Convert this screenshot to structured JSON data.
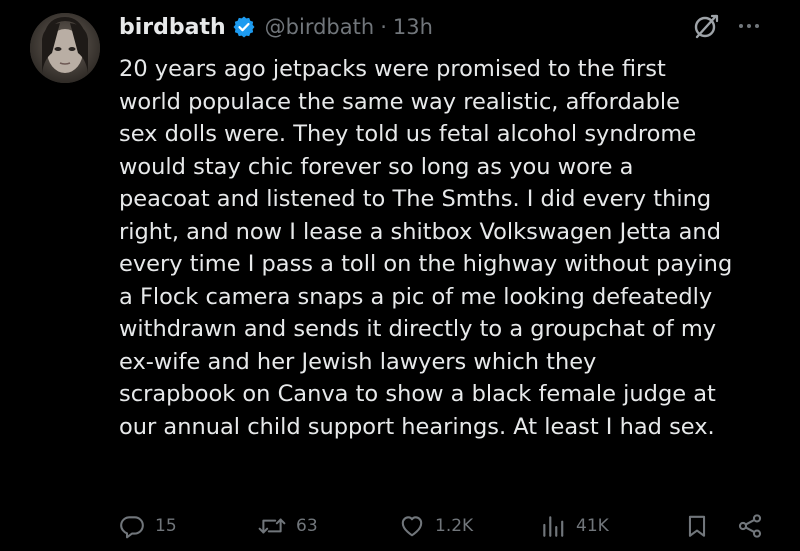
{
  "author": {
    "display_name": "birdbath",
    "handle": "@birdbath",
    "separator": "·",
    "time": "13h",
    "verified": true
  },
  "tweet_lines": [
    "20 years ago jetpacks were promised to the first",
    "world populace the same way realistic, affordable",
    "sex dolls were. They told us fetal alcohol syndrome",
    "would stay chic forever so long as you wore a",
    "peacoat and listened to The Smths. I did every thing",
    "right, and now I lease a shitbox Volkswagen Jetta and",
    "every time I pass a toll on the highway without paying",
    "a Flock camera snaps a pic of me looking defeatedly",
    "withdrawn and sends it directly to a groupchat of my",
    "ex-wife and her Jewish lawyers which they",
    "scrapbook on Canva to show a black female judge at",
    "our annual child support hearings. At least I had sex."
  ],
  "actions": {
    "replies": "15",
    "reposts": "63",
    "likes": "1.2K",
    "views": "41K"
  },
  "icons": {
    "verified": "verified-badge-icon",
    "grok": "grok-icon",
    "more": "more-icon",
    "reply": "reply-icon",
    "repost": "repost-icon",
    "like": "like-icon",
    "views": "views-icon",
    "bookmark": "bookmark-icon",
    "share": "share-icon"
  },
  "colors": {
    "background": "#000000",
    "primary_text": "#e7e9ea",
    "secondary_text": "#71767b",
    "verified_blue": "#1d9bf0"
  }
}
